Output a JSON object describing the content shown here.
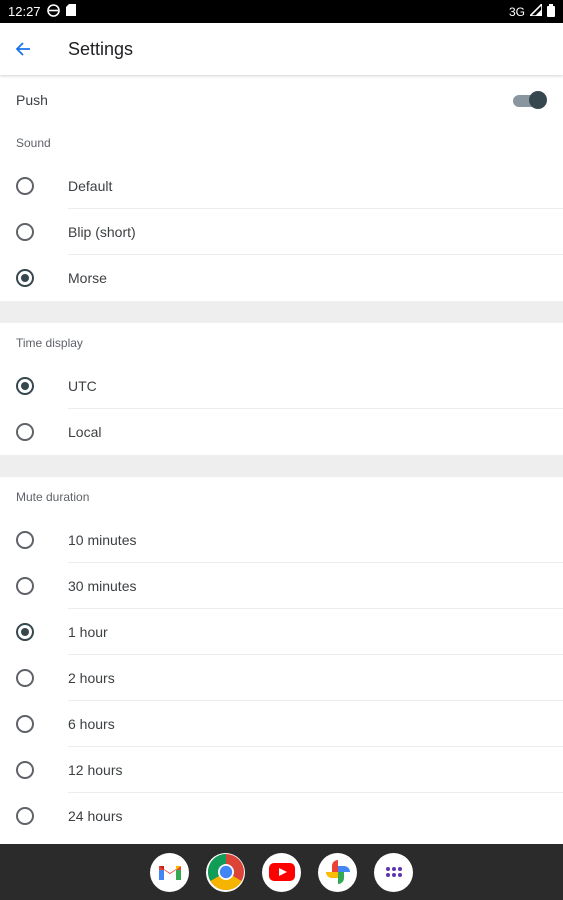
{
  "status_bar": {
    "time": "12:27",
    "network": "3G"
  },
  "app_bar": {
    "title": "Settings"
  },
  "push": {
    "label": "Push",
    "enabled": true
  },
  "sections": [
    {
      "id": "sound",
      "title": "Sound",
      "options": [
        {
          "label": "Default",
          "checked": false
        },
        {
          "label": "Blip (short)",
          "checked": false
        },
        {
          "label": "Morse",
          "checked": true
        }
      ]
    },
    {
      "id": "time",
      "title": "Time display",
      "options": [
        {
          "label": "UTC",
          "checked": true
        },
        {
          "label": "Local",
          "checked": false
        }
      ]
    },
    {
      "id": "mute",
      "title": "Mute duration",
      "options": [
        {
          "label": "10 minutes",
          "checked": false
        },
        {
          "label": "30 minutes",
          "checked": false
        },
        {
          "label": "1 hour",
          "checked": true
        },
        {
          "label": "2 hours",
          "checked": false
        },
        {
          "label": "6 hours",
          "checked": false
        },
        {
          "label": "12 hours",
          "checked": false
        },
        {
          "label": "24 hours",
          "checked": false
        }
      ]
    }
  ],
  "dock": [
    {
      "name": "gmail-icon"
    },
    {
      "name": "chrome-icon"
    },
    {
      "name": "youtube-icon"
    },
    {
      "name": "photos-icon"
    },
    {
      "name": "app-drawer-icon"
    }
  ],
  "colors": {
    "accent": "#1a73e8",
    "radio_checked": "#37474f",
    "divider_band": "#eeeeee"
  }
}
